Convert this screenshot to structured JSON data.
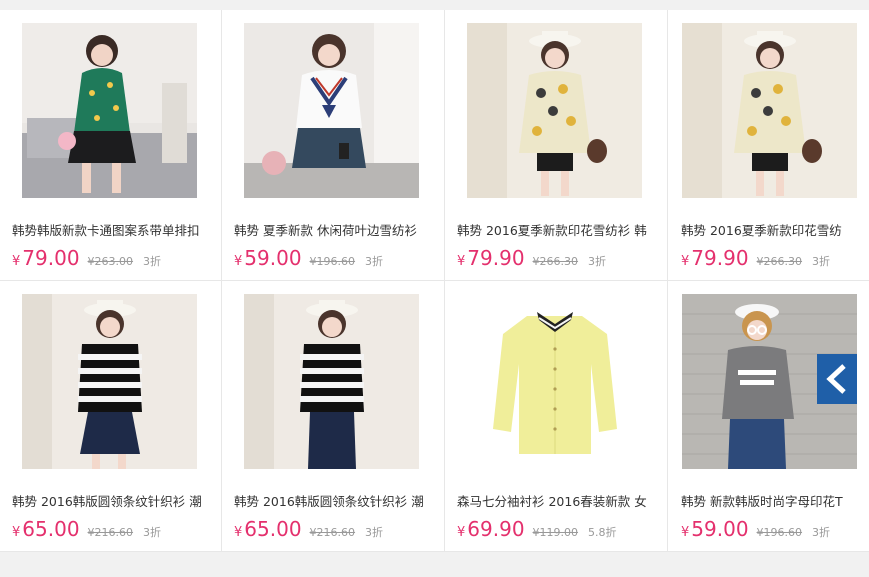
{
  "currency_symbol": "¥",
  "colors": {
    "price": "#e4306d",
    "muted": "#999999",
    "title": "#333333"
  },
  "products": [
    {
      "title": "韩势韩版新款卡通图案系带单排扣",
      "price": "79.00",
      "original_price": "¥263.00",
      "discount": "3折",
      "image": "model-green-print-blouse"
    },
    {
      "title": "韩势 夏季新款 休闲荷叶边雪纺衫",
      "price": "59.00",
      "original_price": "¥196.60",
      "discount": "3折",
      "image": "model-white-sailor-top"
    },
    {
      "title": "韩势 2016夏季新款印花雪纺衫 韩",
      "price": "79.90",
      "original_price": "¥266.30",
      "discount": "3折",
      "image": "model-floral-chiffon-top"
    },
    {
      "title": "韩势 2016夏季新款印花雪纺",
      "price": "79.90",
      "original_price": "¥266.30",
      "discount": "3折",
      "image": "model-floral-chiffon-top"
    },
    {
      "title": "韩势 2016韩版圆领条纹针织衫 潮",
      "price": "65.00",
      "original_price": "¥216.60",
      "discount": "3折",
      "image": "model-striped-knit-top"
    },
    {
      "title": "韩势 2016韩版圆领条纹针织衫 潮",
      "price": "65.00",
      "original_price": "¥216.60",
      "discount": "3折",
      "image": "model-striped-knit-top"
    },
    {
      "title": "森马七分袖衬衫 2016春装新款 女",
      "price": "69.90",
      "original_price": "¥119.00",
      "discount": "5.8折",
      "image": "yellow-shirt-product"
    },
    {
      "title": "韩势 新款韩版时尚字母印花T",
      "price": "59.00",
      "original_price": "¥196.60",
      "discount": "3折",
      "image": "model-grey-letter-tee"
    }
  ]
}
